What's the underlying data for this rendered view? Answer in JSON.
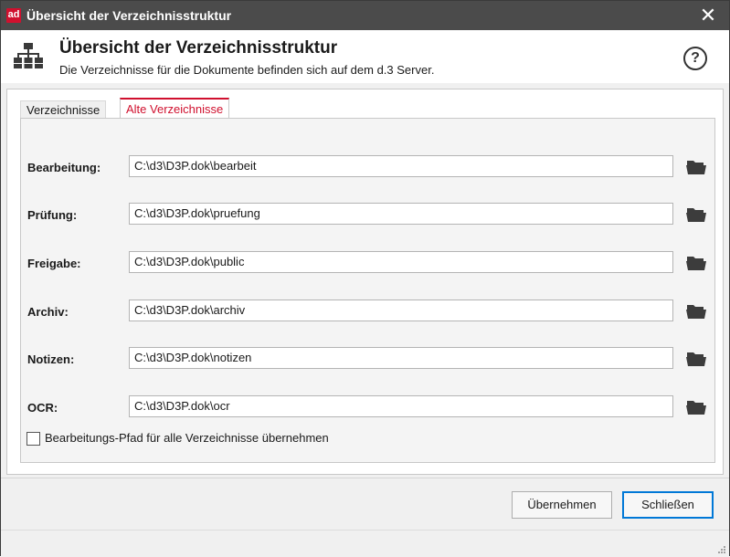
{
  "window": {
    "app_logo": "ad",
    "title": "Übersicht der Verzeichnisstruktur",
    "close_glyph": "✕"
  },
  "header": {
    "icon": "folder-tree-icon",
    "title": "Übersicht der Verzeichnisstruktur",
    "subtitle": "Die Verzeichnisse für die Dokumente befinden sich auf dem d.3 Server.",
    "help_glyph": "?"
  },
  "tabs": [
    {
      "label": "Verzeichnisse",
      "active": false
    },
    {
      "label": "Alte Verzeichnisse",
      "active": true
    }
  ],
  "fields": [
    {
      "key": "bearbeitung",
      "label": "Bearbeitung:",
      "value": "C:\\d3\\D3P.dok\\bearbeit"
    },
    {
      "key": "pruefung",
      "label": "Prüfung:",
      "value": "C:\\d3\\D3P.dok\\pruefung"
    },
    {
      "key": "freigabe",
      "label": "Freigabe:",
      "value": "C:\\d3\\D3P.dok\\public"
    },
    {
      "key": "archiv",
      "label": "Archiv:",
      "value": "C:\\d3\\D3P.dok\\archiv"
    },
    {
      "key": "notizen",
      "label": "Notizen:",
      "value": "C:\\d3\\D3P.dok\\notizen"
    },
    {
      "key": "ocr",
      "label": "OCR:",
      "value": "C:\\d3\\D3P.dok\\ocr"
    }
  ],
  "checkbox": {
    "label": "Bearbeitungs-Pfad für alle Verzeichnisse übernehmen",
    "checked": false
  },
  "buttons": {
    "apply_label": "Übernehmen",
    "close_label": "Schließen"
  },
  "colors": {
    "titlebar": "#4b4b4b",
    "accent": "#d0102e",
    "focus": "#0078d7"
  }
}
